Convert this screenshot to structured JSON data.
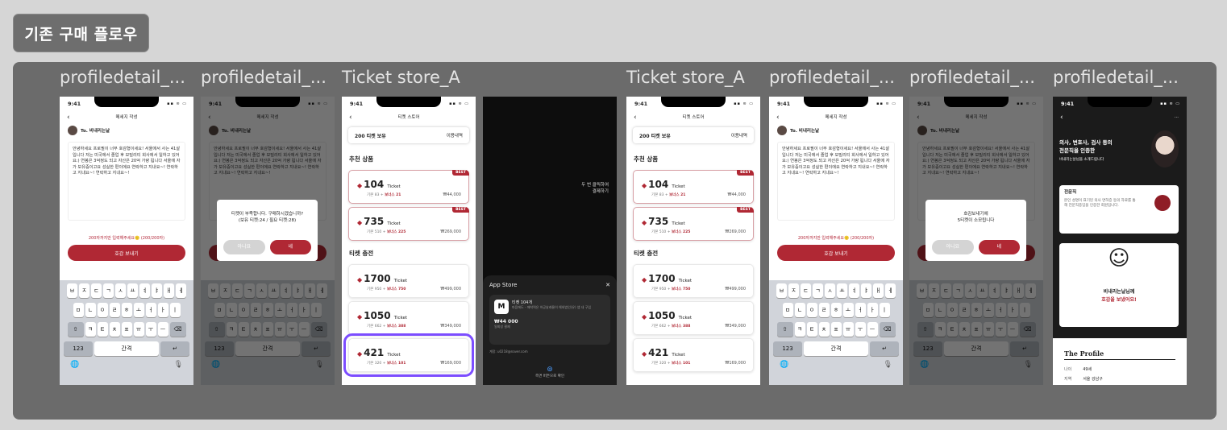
{
  "section_title": "기존 구매 플로우",
  "frame_labels": [
    "profiledetail_...",
    "profiledetail_...",
    "Ticket store_A",
    "Ticket store_A",
    "profiledetail_...",
    "profiledetail_...",
    "profiledetail_..."
  ],
  "status_time": "9:41",
  "status_icons": "▪︎▪︎ ≋ ▭",
  "message": {
    "nav_title": "메세지 작성",
    "to_label": "To. 비내리는날",
    "body": "안녕하세요 프로필이 너무 호감형이세요! 서울에서 사는 41살입니다 저는 미국에서 졸업 후 모빌리티 회사에서 일하고 있어요:) 연봉은 3억정도 되고 자산은 20억 가량 됩니다 서울에 자가 보유중이고요 성실한 편이에요 연락하고 지내요~! 연락하고 지내요~! 연락하고 지내요~!",
    "counter": "200자까지만 입력해주세요🙂 (200/200자)",
    "send_label": "호감 보내기"
  },
  "keyboard": {
    "row1": [
      "ㅂ",
      "ㅈ",
      "ㄷ",
      "ㄱ",
      "ㅅ",
      "ㅛ",
      "ㅕ",
      "ㅑ",
      "ㅐ",
      "ㅔ"
    ],
    "row2": [
      "ㅁ",
      "ㄴ",
      "ㅇ",
      "ㄹ",
      "ㅎ",
      "ㅗ",
      "ㅓ",
      "ㅏ",
      "ㅣ"
    ],
    "row3": [
      "ㅋ",
      "ㅌ",
      "ㅊ",
      "ㅍ",
      "ㅠ",
      "ㅜ",
      "ㅡ"
    ],
    "shift": "⇧",
    "delete": "⌫",
    "num": "123",
    "space": "간격",
    "return": "↵",
    "globe": "🌐",
    "mic": "🎙"
  },
  "modal_ticket_short": {
    "text_line1": "티켓이 부족합니다. 구매하시겠습니까?",
    "text_line2": "(보유 티켓:24 / 필요 티켓:28)",
    "no": "아니요",
    "yes": "네"
  },
  "modal_confirm": {
    "text_line1": "호감보내기에",
    "text_line2": "5티켓이 소모됩니다",
    "no": "아니요",
    "yes": "네"
  },
  "store": {
    "nav_title": "티켓 스토어",
    "holding": "200 티켓 보유",
    "history": "이용내역",
    "recommended_title": "추천 상품",
    "charge_title": "티켓 충전",
    "ticket_word": "Ticket",
    "best_badge": "BEST",
    "recommended": [
      {
        "amount": "104",
        "base": "기본 83",
        "bonus": "보너스 21",
        "price": "₩44,000"
      },
      {
        "amount": "735",
        "base": "기본 510",
        "bonus": "보너스 225",
        "price": "₩269,000"
      }
    ],
    "charge": [
      {
        "amount": "1700",
        "base": "기본 950",
        "bonus": "보너스 750",
        "price": "₩499,000"
      },
      {
        "amount": "1050",
        "base": "기본 662",
        "bonus": "보너스 388",
        "price": "₩349,000"
      },
      {
        "amount": "421",
        "base": "기본 320",
        "bonus": "보너스 101",
        "price": "₩169,000"
      }
    ]
  },
  "appstore": {
    "title": "App Store",
    "close": "✕",
    "item": "티켓 104개",
    "item_sub": "마음에도 - 애착력은 허공날래물이 해외법인(유) 앱 내 구입",
    "price": "₩44 000",
    "price_sub": "일회성 결제",
    "account": "계정: u0218@naver.com",
    "confirm": "측면 버튼으로 확인",
    "side_hint_line1": "두 번 클릭하여",
    "side_hint_line2": "결제하기",
    "logo_letter": "M"
  },
  "profile": {
    "headline_line1": "의사, 변호사, 검사 등의",
    "headline_line2": "전문직을 인증한",
    "intro": "비내리는날님을 소개드립니다",
    "cert_title": "전문직",
    "cert_body": "본인 성명이 표기된 의사 면허증 등의 자료를 통해 전문직종임을 인증한 회원입니다.",
    "sent_line1": "비내리는날님께",
    "sent_line2": "호감을 보냈어요!",
    "profile_title": "The Profile",
    "age_label": "나이",
    "age_value": "49세",
    "region_label": "지역",
    "region_value": "서울 강남구"
  },
  "colors": {
    "accent": "#b02834",
    "selection": "#7c4dff",
    "board": "#6b6b6b"
  }
}
